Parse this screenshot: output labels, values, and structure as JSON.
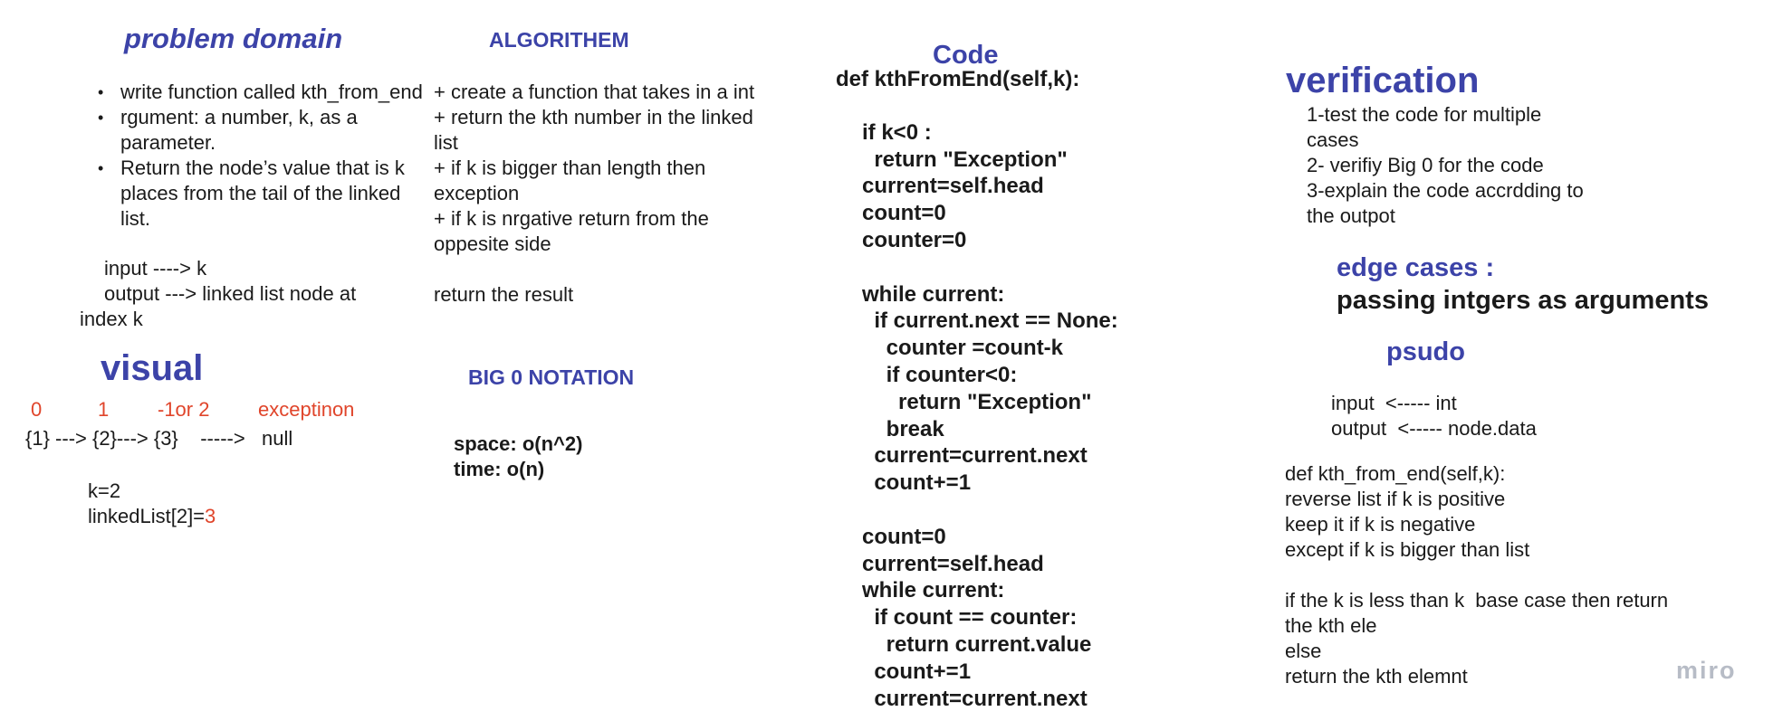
{
  "problem_domain": {
    "title": "problem domain",
    "bullets": [
      "write function called kth_from_end",
      "rgument: a number, k, as a parameter.",
      "Return the node’s value that is k places from the tail of the linked list."
    ],
    "input_line": "input ----> k",
    "output_line": "output ---> linked list node at",
    "output_cont": "index k"
  },
  "visual": {
    "title": "visual",
    "labels": [
      "0",
      "1",
      "-1or 2",
      "exceptinon"
    ],
    "list_line": "{1} ---> {2}---> {3}    ----->   null",
    "k_line": "k=2",
    "linked_prefix": "linkedList[2]=",
    "linked_value": "3"
  },
  "algorithm": {
    "title": "ALGORITHEM",
    "lines": [
      "+ create a function that takes in a int",
      "+ return the kth number in the linked",
      "list",
      "+ if  k is bigger than length then",
      "exception",
      "+ if k is nrgative return from the",
      "oppesite side",
      "",
      "return the result"
    ]
  },
  "big_o": {
    "title": "BIG 0 NOTATION",
    "space": "space: o(n^2)",
    "time": "time: o(n)"
  },
  "code": {
    "title": "Code",
    "def_line": "def kthFromEnd(self,k):",
    "lines": [
      "",
      "if k<0 :",
      "  return \"Exception\"",
      "current=self.head",
      "count=0",
      "counter=0",
      "",
      "while current:",
      "  if current.next == None:",
      "    counter =count-k",
      "    if counter<0:",
      "      return \"Exception\"",
      "    break",
      "  current=current.next",
      "  count+=1",
      "",
      "count=0",
      "current=self.head",
      "while current:",
      "  if count == counter:",
      "    return current.value",
      "  count+=1",
      "  current=current.next"
    ]
  },
  "verification": {
    "title": "verification",
    "lines": [
      "1-test the code for multiple",
      "cases",
      "2- verifiy Big 0 for the code",
      "3-explain the code accrdding to",
      "the outpot"
    ]
  },
  "edge_cases": {
    "title": "edge cases :",
    "text": "passing intgers as arguments"
  },
  "psudo": {
    "title": "psudo",
    "input_line": "input  <----- int",
    "output_line": "output  <----- node.data",
    "lines": [
      "def kth_from_end(self,k):",
      "reverse list if k is positive",
      "keep it if k is negative",
      "except if k is bigger than list",
      "",
      "if the k is less than k  base case then return",
      "the kth ele",
      "else",
      "return the kth elemnt"
    ]
  },
  "watermark": "miro",
  "colors": {
    "accent_blue": "#3c43a8",
    "accent_red": "#e0452b",
    "watermark": "#b7bcc6"
  }
}
